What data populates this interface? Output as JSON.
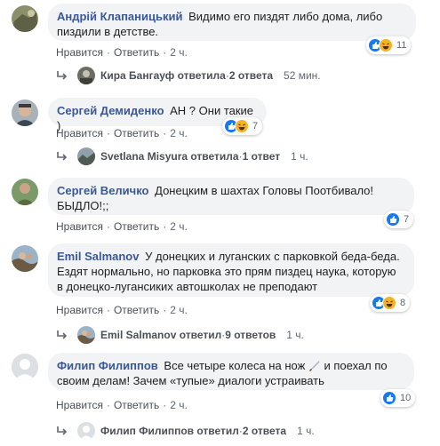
{
  "comments": [
    {
      "author": "Андрій Клапаницький",
      "text": "Видимо его пиздят либо дома, либо пиздили в детстве.",
      "like_label": "Нравится",
      "reply_label": "Ответить",
      "time": "2 ч.",
      "reactions": [
        "like-icon",
        "haha-icon"
      ],
      "reaction_count": "11",
      "reply_summary": {
        "name": "Кира Бангауф ответила",
        "count": "2 ответа",
        "time": "52 мин."
      }
    },
    {
      "author": "Сергей Демиденко",
      "text": "АН ? Они такие )",
      "like_label": "Нравится",
      "reply_label": "Ответить",
      "time": "2 ч.",
      "reactions": [
        "like-icon",
        "haha-icon"
      ],
      "reaction_count": "7",
      "reply_summary": {
        "name": "Svetlana Misyura ответила",
        "count": "1 ответ",
        "time": "1 ч."
      }
    },
    {
      "author": "Сергей Величко",
      "text": "Донецким в шахтах Головы Поотбивало! БЫДЛО!;;",
      "like_label": "Нравится",
      "reply_label": "Ответить",
      "time": "2 ч.",
      "reactions": [
        "like-icon"
      ],
      "reaction_count": "7"
    },
    {
      "author": "Emil Salmanov",
      "text": "У донецких и луганских с парковкой беда-беда. Ездят нормально, но парковка это прям пиздец наука, которую в донецко-лугансиких автошколах не преподают",
      "like_label": "Нравится",
      "reply_label": "Ответить",
      "time": "2 ч.",
      "reactions": [
        "like-icon",
        "haha-icon"
      ],
      "reaction_count": "8",
      "reply_summary": {
        "name": "Emil Salmanov ответил",
        "count": "9 ответов",
        "time": "1 ч."
      }
    },
    {
      "author": "Филип Филиппов",
      "text": "Все четыре колеса на нож ",
      "text_after": " и поехал по своим делам! Зачем «тупые» диалоги устраивать",
      "like_label": "Нравится",
      "reply_label": "Ответить",
      "time": "2 ч.",
      "reactions": [
        "like-icon"
      ],
      "reaction_count": "10",
      "reply_summary": {
        "name": "Филип Филиппов ответил",
        "count": "2 ответа",
        "time": "1 ч."
      }
    }
  ],
  "colors": {
    "author": "#385898",
    "bubble": "#f2f3f5",
    "like": "#1877f2",
    "haha": "#f7b125"
  }
}
